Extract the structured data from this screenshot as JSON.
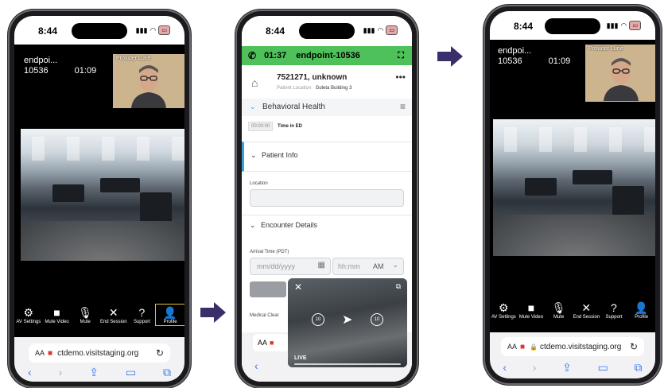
{
  "status": {
    "time": "8:44"
  },
  "left": {
    "endpoint_line1": "endpoi...",
    "endpoint_line2": "10536",
    "call_time": "01:09",
    "provider_label": "Provider Lurie",
    "toolbar": [
      {
        "label": "AV Settings",
        "icon": "gear-icon",
        "glyph": "⚙"
      },
      {
        "label": "Mute Video",
        "icon": "video-camera-icon",
        "glyph": "■"
      },
      {
        "label": "Mute",
        "icon": "microphone-icon",
        "glyph": "🎙"
      },
      {
        "label": "End Session",
        "icon": "close-icon",
        "glyph": "✕"
      },
      {
        "label": "Support",
        "icon": "help-icon",
        "glyph": "?"
      },
      {
        "label": "Profile",
        "icon": "profile-icon",
        "glyph": "👤"
      }
    ],
    "url_aa": "AA",
    "url": "ctdemo.visitstaging.org"
  },
  "middle": {
    "call_time": "01:37",
    "endpoint": "endpoint-10536",
    "patient_name": "7521271, unknown",
    "patient_location_label": "Patient Location",
    "patient_location_value": "Goleta Building 3",
    "section_behavioral": "Behavioral Health",
    "timer_value": "00:00:00",
    "timer_label": "Time in ED",
    "section_patient_info": "Patient Info",
    "location_label": "Location",
    "section_encounter": "Encounter Details",
    "arrival_label": "Arrival Time (PDT)",
    "date_placeholder": "mm/dd/yyyy",
    "time_placeholder": "hh:mm",
    "ampm": "AM",
    "medical_clear": "Medical Clear",
    "pip_live": "LIVE",
    "pip_skip_back": "10",
    "pip_skip_fwd": "10",
    "url_aa": "AA"
  },
  "right": {
    "endpoint_line1": "endpoi...",
    "endpoint_line2": "10536",
    "call_time": "01:09",
    "provider_label": "Provider Lurie",
    "toolbar": [
      {
        "label": "AV Settings",
        "icon": "gear-icon",
        "glyph": "⚙"
      },
      {
        "label": "Mute Video",
        "icon": "video-camera-icon",
        "glyph": "■"
      },
      {
        "label": "Mute",
        "icon": "microphone-icon",
        "glyph": "🎙"
      },
      {
        "label": "End Session",
        "icon": "close-icon",
        "glyph": "✕"
      },
      {
        "label": "Support",
        "icon": "help-icon",
        "glyph": "?"
      },
      {
        "label": "Profile",
        "icon": "profile-icon",
        "glyph": "👤"
      }
    ],
    "url_aa": "AA",
    "url": "ctdemo.visitstaging.org"
  },
  "colors": {
    "accent_green": "#4fc15a",
    "arrow": "#3b2f6b",
    "link_blue": "#3478f6",
    "highlight": "#e0c030"
  }
}
